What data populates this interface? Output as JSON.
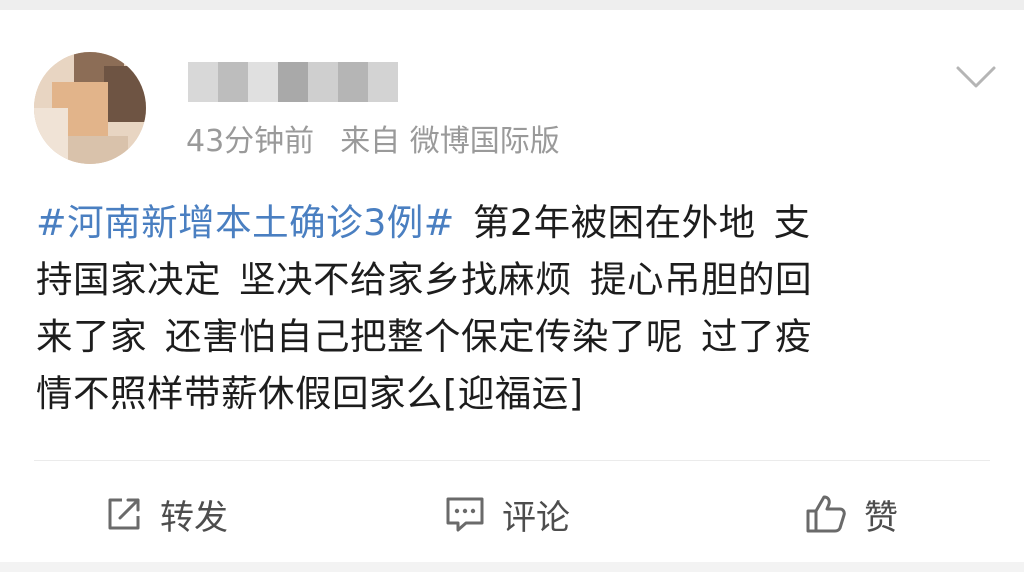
{
  "post": {
    "author": {
      "name": "",
      "avatar_icon": "avatar-icon"
    },
    "time": "43分钟前",
    "source": "来自 微博国际版",
    "hashtag": "#河南新增本土确诊3例#",
    "body_lines": [
      "第2年被困在外地",
      "支",
      "持国家决定",
      "坚决不给家乡找麻烦",
      "提心吊胆的回",
      "来了家",
      "还害怕自己把整个保定传染了呢",
      "过了疫",
      "情不照样带薪休假回家么[迎福运]"
    ]
  },
  "actions": {
    "repost_label": "转发",
    "comment_label": "评论",
    "like_label": "赞"
  },
  "icons": {
    "more": "chevron-down-icon",
    "repost": "share-icon",
    "comment": "comment-icon",
    "like": "thumbs-up-icon"
  },
  "colors": {
    "hashtag": "#4a7fc1",
    "meta_text": "#9a9a9a",
    "body_text": "#1d1d1d",
    "action_text": "#4d4d4d"
  }
}
